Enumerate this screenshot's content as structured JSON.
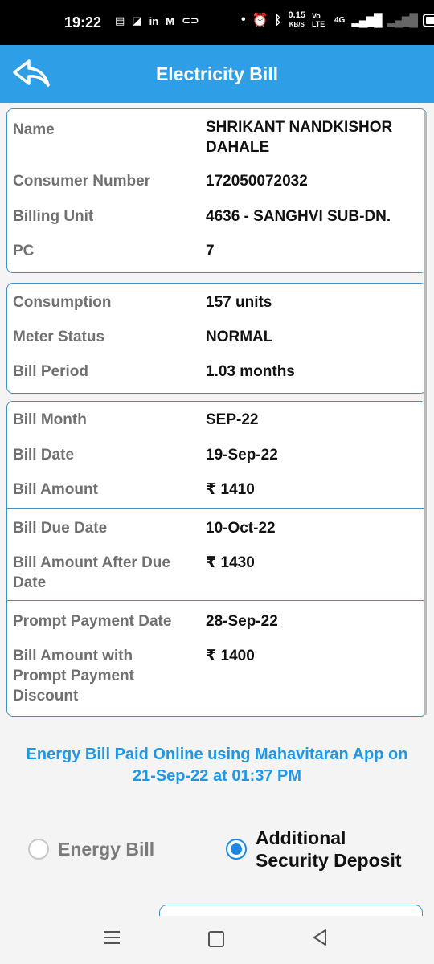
{
  "status": {
    "time": "19:22",
    "net_speed_value": "0.15",
    "net_speed_unit": "KB/S",
    "volte": "Vo LTE",
    "network": "4G"
  },
  "appbar": {
    "title": "Electricity Bill"
  },
  "consumer": {
    "name_label": "Name",
    "name_value_line1": "SHRIKANT NANDKISHOR",
    "name_value_line2": "DAHALE",
    "number_label": "Consumer Number",
    "number_value": "172050072032",
    "unit_label": "Billing Unit",
    "unit_value": "4636 - SANGHVI SUB-DN.",
    "pc_label": "PC",
    "pc_value": "7"
  },
  "usage": {
    "consumption_label": "Consumption",
    "consumption_value": "157 units",
    "meter_label": "Meter Status",
    "meter_value": "NORMAL",
    "period_label": "Bill Period",
    "period_value": "1.03 months"
  },
  "bill": {
    "month_label": "Bill Month",
    "month_value": "SEP-22",
    "date_label": "Bill Date",
    "date_value": "19-Sep-22",
    "amount_label": "Bill Amount",
    "amount_value": "₹ 1410",
    "due_label": "Bill Due Date",
    "due_value": "10-Oct-22",
    "after_due_label_line1": "Bill Amount After Due",
    "after_due_label_line2": "Date",
    "after_due_value": "₹ 1430",
    "prompt_date_label": "Prompt Payment Date",
    "prompt_date_value": "28-Sep-22",
    "prompt_amount_label_line1": "Bill Amount with",
    "prompt_amount_label_line2": "Prompt Payment",
    "prompt_amount_label_line3": "Discount",
    "prompt_amount_value": "₹ 1400"
  },
  "notice": {
    "line1": "Energy Bill Paid Online using Mahavitaran App on",
    "line2": "21-Sep-22 at 01:37 PM"
  },
  "payment_options": {
    "energy_label": "Energy Bill",
    "deposit_label_line1": "Additional",
    "deposit_label_line2": "Security Deposit",
    "selected": "Additional Security Deposit"
  },
  "colors": {
    "accent": "#2e9fe6",
    "notice": "#1e98e6",
    "card_border": "#3a93c8"
  }
}
